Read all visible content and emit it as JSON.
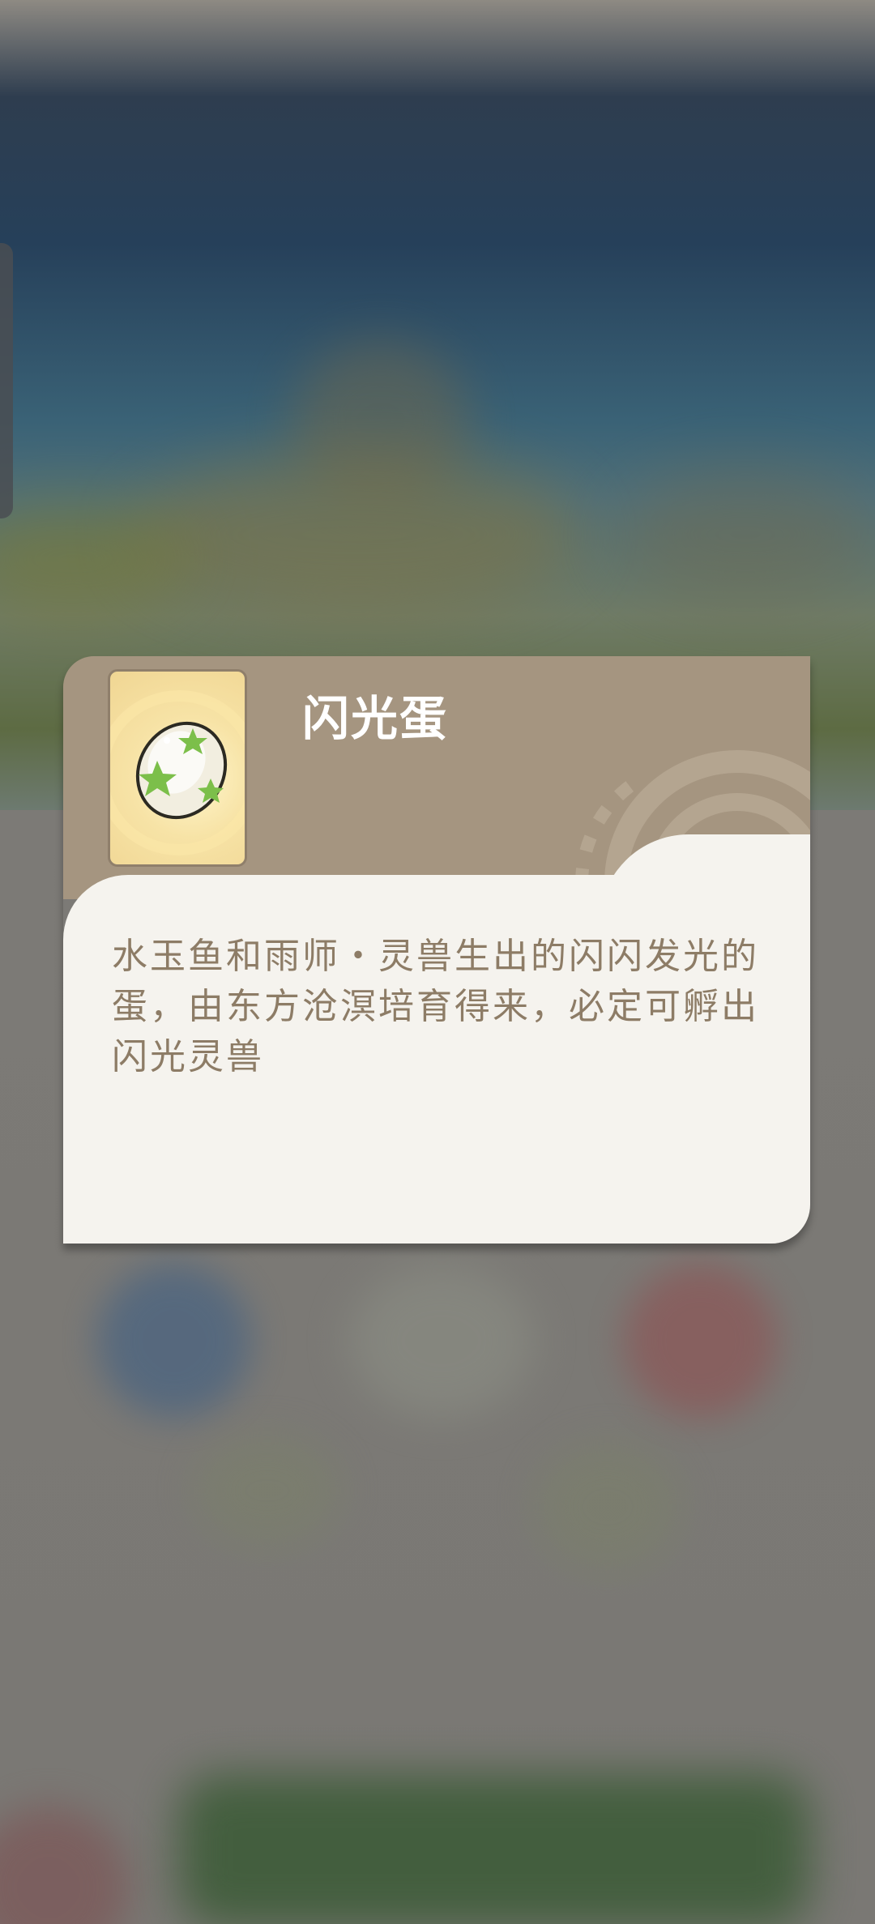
{
  "item_popup": {
    "title": "闪光蛋",
    "description": "水玉鱼和雨师・灵兽生出的闪闪发光的蛋，由东方沧溟培育得来，必定可孵出闪光灵兽",
    "icon": "spotted-egg-icon"
  },
  "colors": {
    "card_header": "#a59580",
    "card_body": "#f5f3ee",
    "description_text": "#8d7c66",
    "title_text": "#ffffff"
  }
}
